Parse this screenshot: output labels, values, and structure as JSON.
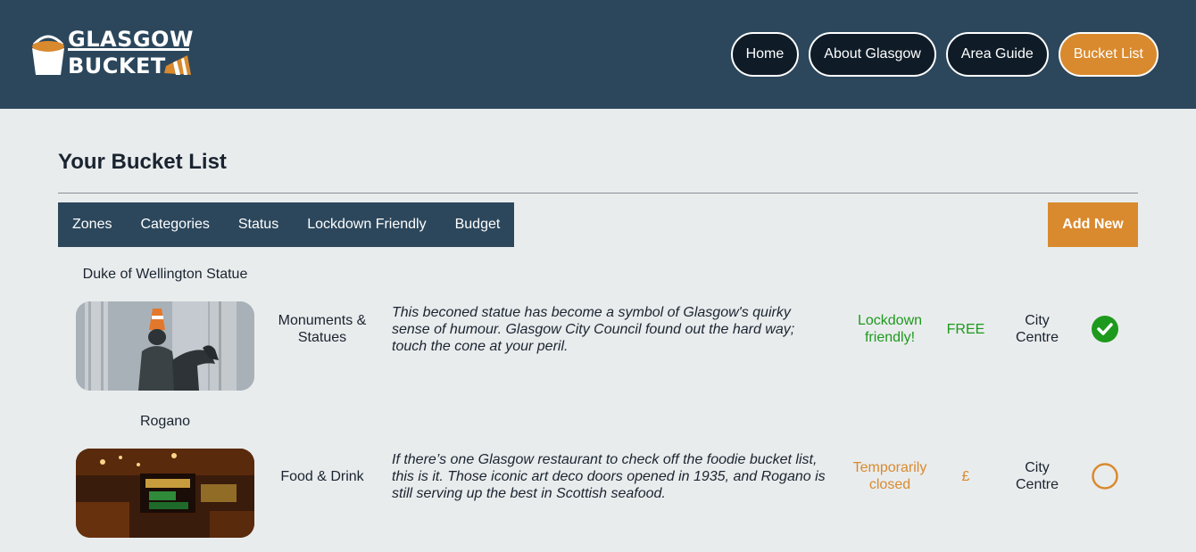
{
  "brand": {
    "line1": "GLASGOW",
    "line2": "BUCKET"
  },
  "nav": {
    "items": [
      {
        "label": "Home"
      },
      {
        "label": "About Glasgow"
      },
      {
        "label": "Area Guide"
      },
      {
        "label": "Bucket List"
      }
    ]
  },
  "main": {
    "title": "Your Bucket List",
    "filters": [
      "Zones",
      "Categories",
      "Status",
      "Lockdown Friendly",
      "Budget"
    ],
    "add_label": "Add New"
  },
  "items": [
    {
      "name": "Duke of Wellington Statue",
      "category": "Monuments & Statues",
      "description": "This beconed statue has become a symbol of Glasgow's quirky sense of humour. Glasgow City Council found out the hard way; touch the cone at your peril.",
      "lockdown": "Lockdown friendly!",
      "budget": "FREE",
      "zone": "City Centre",
      "status_icon": "check-circle-icon"
    },
    {
      "name": "Rogano",
      "category": "Food & Drink",
      "description": "If there’s one Glasgow restaurant to check off the foodie bucket list, this is it. Those iconic art deco doors opened in 1935, and Rogano is still serving up the best in Scottish seafood.",
      "lockdown": "Temporarily closed",
      "budget": "£",
      "zone": "City Centre",
      "status_icon": "empty-circle-icon"
    }
  ],
  "colors": {
    "header_bg": "#2c475c",
    "accent": "#d98a2e",
    "nav_btn_bg": "#0f1c28",
    "success": "#1d9a1d",
    "page_bg": "#e9eced"
  }
}
